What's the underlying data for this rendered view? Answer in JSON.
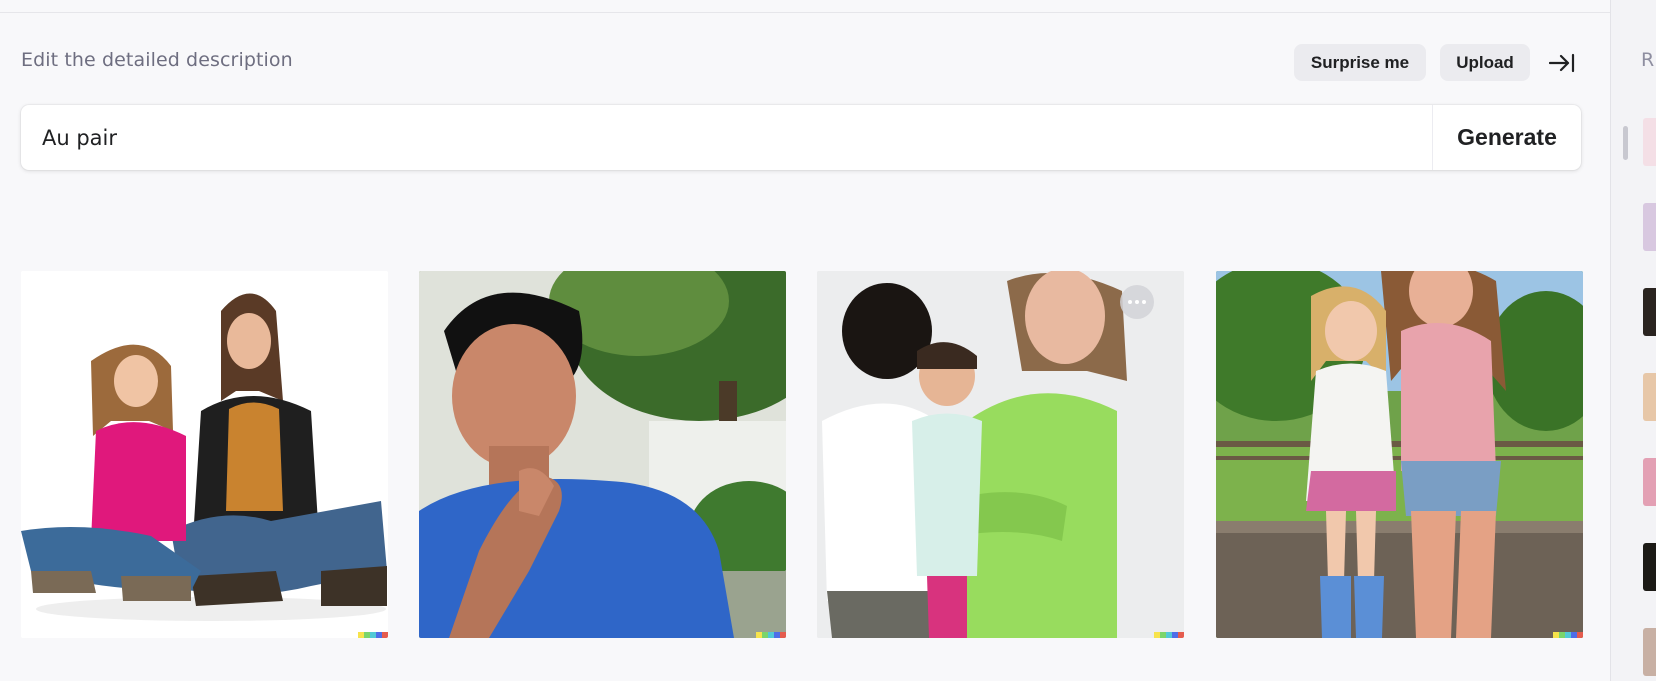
{
  "header": {
    "description_label": "Edit the detailed description",
    "surprise_label": "Surprise me",
    "upload_label": "Upload"
  },
  "prompt": {
    "value": "Au pair",
    "generate_label": "Generate"
  },
  "results": [
    {
      "subject": "woman-and-girl-sitting"
    },
    {
      "subject": "man-thinking-blue-shirt"
    },
    {
      "subject": "woman-with-two-boys"
    },
    {
      "subject": "woman-and-girl-outdoors"
    }
  ],
  "history": {
    "title": "R",
    "thumbnails": 7
  },
  "colors": {
    "background": "#f8f8fa",
    "chip": "#ebebef",
    "text": "#202123",
    "muted": "#6e6e80",
    "signature": [
      "#f7e34c",
      "#7bd56b",
      "#52c9d6",
      "#4f6ee8",
      "#e55c4e"
    ]
  }
}
